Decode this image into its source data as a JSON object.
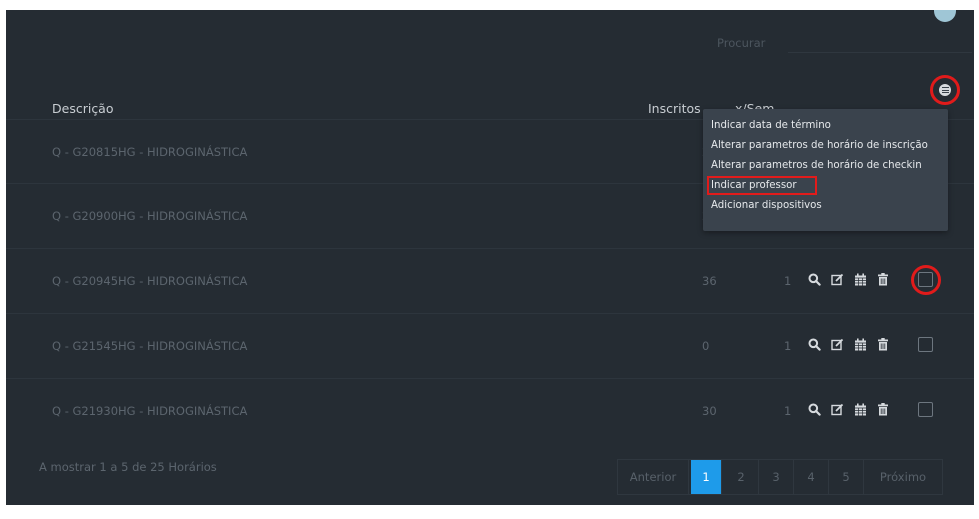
{
  "search": {
    "label": "Procurar",
    "placeholder": ""
  },
  "table": {
    "headers": {
      "description": "Descrição",
      "enrolled": "Inscritos",
      "per_week": "x/Sem"
    },
    "rows": [
      {
        "description": "Q - G20815HG - HIDROGINÁSTICA",
        "enrolled": "2",
        "per_week": ""
      },
      {
        "description": "Q - G20900HG - HIDROGINÁSTICA",
        "enrolled": "2",
        "per_week": ""
      },
      {
        "description": "Q - G20945HG - HIDROGINÁSTICA",
        "enrolled": "36",
        "per_week": "1"
      },
      {
        "description": "Q - G21545HG - HIDROGINÁSTICA",
        "enrolled": "0",
        "per_week": "1"
      },
      {
        "description": "Q - G21930HG - HIDROGINÁSTICA",
        "enrolled": "30",
        "per_week": "1"
      }
    ]
  },
  "menu": {
    "items": [
      "Indicar data de término",
      "Alterar parametros de horário de inscrição",
      "Alterar parametros de horário de checkin",
      "Indicar professor",
      "Adicionar dispositivos"
    ]
  },
  "footer": {
    "info": "A mostrar 1 a 5 de 25 Horários"
  },
  "pagination": {
    "prev": "Anterior",
    "pages": [
      "1",
      "2",
      "3",
      "4",
      "5"
    ],
    "next": "Próximo"
  },
  "colors": {
    "accent": "#1e9bea",
    "highlight": "#e11b1b",
    "panel": "#252c33"
  },
  "icons": [
    "menu-icon",
    "search-icon",
    "edit-icon",
    "calendar-icon",
    "trash-icon"
  ]
}
